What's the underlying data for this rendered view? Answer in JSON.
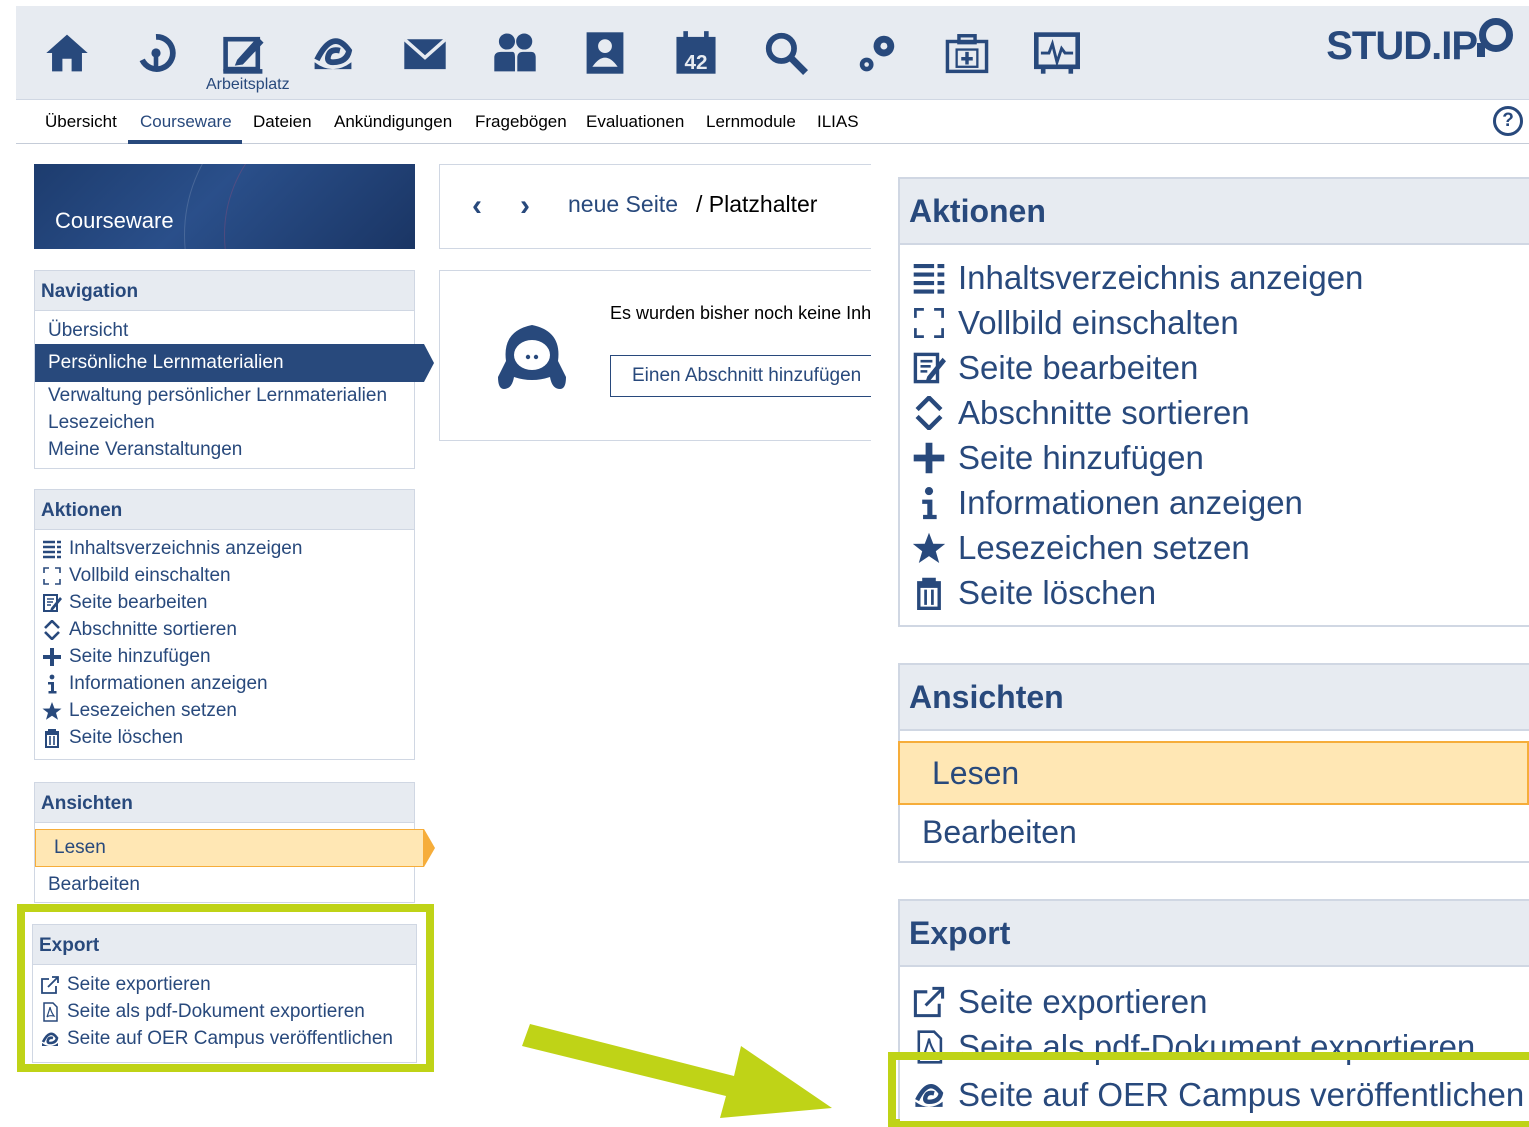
{
  "topnav": {
    "icons": [
      "home-icon",
      "activity-icon",
      "workplace-icon",
      "oer-icon",
      "mail-icon",
      "community-icon",
      "profile-icon",
      "schedule-icon",
      "search-icon",
      "admin-icon",
      "tools-icon",
      "monitor-icon"
    ],
    "active_label": "Arbeitsplatz",
    "logo": "STUD.IP"
  },
  "subnav": {
    "items": [
      "Übersicht",
      "Courseware",
      "Dateien",
      "Ankündigungen",
      "Fragebögen",
      "Evaluationen",
      "Lernmodule",
      "ILIAS"
    ],
    "active": "Courseware",
    "help": "?"
  },
  "sidebar": {
    "title": "Courseware",
    "navigation": {
      "heading": "Navigation",
      "items": [
        "Übersicht",
        "Persönliche Lernmaterialien",
        "Verwaltung persönlicher Lernmaterialien",
        "Lesezeichen",
        "Meine Veranstaltungen"
      ]
    },
    "actions": {
      "heading": "Aktionen",
      "items": [
        {
          "label": "Inhaltsverzeichnis anzeigen",
          "icon": "toc-icon"
        },
        {
          "label": "Vollbild einschalten",
          "icon": "fullscreen-icon"
        },
        {
          "label": "Seite bearbeiten",
          "icon": "edit-icon"
        },
        {
          "label": "Abschnitte sortieren",
          "icon": "sort-icon"
        },
        {
          "label": "Seite hinzufügen",
          "icon": "add-icon"
        },
        {
          "label": "Informationen anzeigen",
          "icon": "info-icon"
        },
        {
          "label": "Lesezeichen setzen",
          "icon": "star-icon"
        },
        {
          "label": "Seite löschen",
          "icon": "trash-icon"
        }
      ]
    },
    "views": {
      "heading": "Ansichten",
      "items": [
        "Lesen",
        "Bearbeiten"
      ],
      "active": "Lesen"
    },
    "export": {
      "heading": "Export",
      "items": [
        {
          "label": "Seite exportieren",
          "icon": "export-icon"
        },
        {
          "label": "Seite als pdf-Dokument exportieren",
          "icon": "pdf-icon"
        },
        {
          "label": "Seite auf OER Campus veröffentlichen",
          "icon": "oer-icon"
        }
      ]
    }
  },
  "main": {
    "breadcrumb": {
      "link": "neue Seite",
      "current": "/ Platzhalter"
    },
    "empty_message": "Es wurden bisher noch keine Inhalte eingepflegt.",
    "add_section_button": "Einen Abschnitt hinzufügen"
  },
  "colors": {
    "accent": "#28497c",
    "highlight": "#bfd317",
    "active_view": "#ffe7b4"
  }
}
